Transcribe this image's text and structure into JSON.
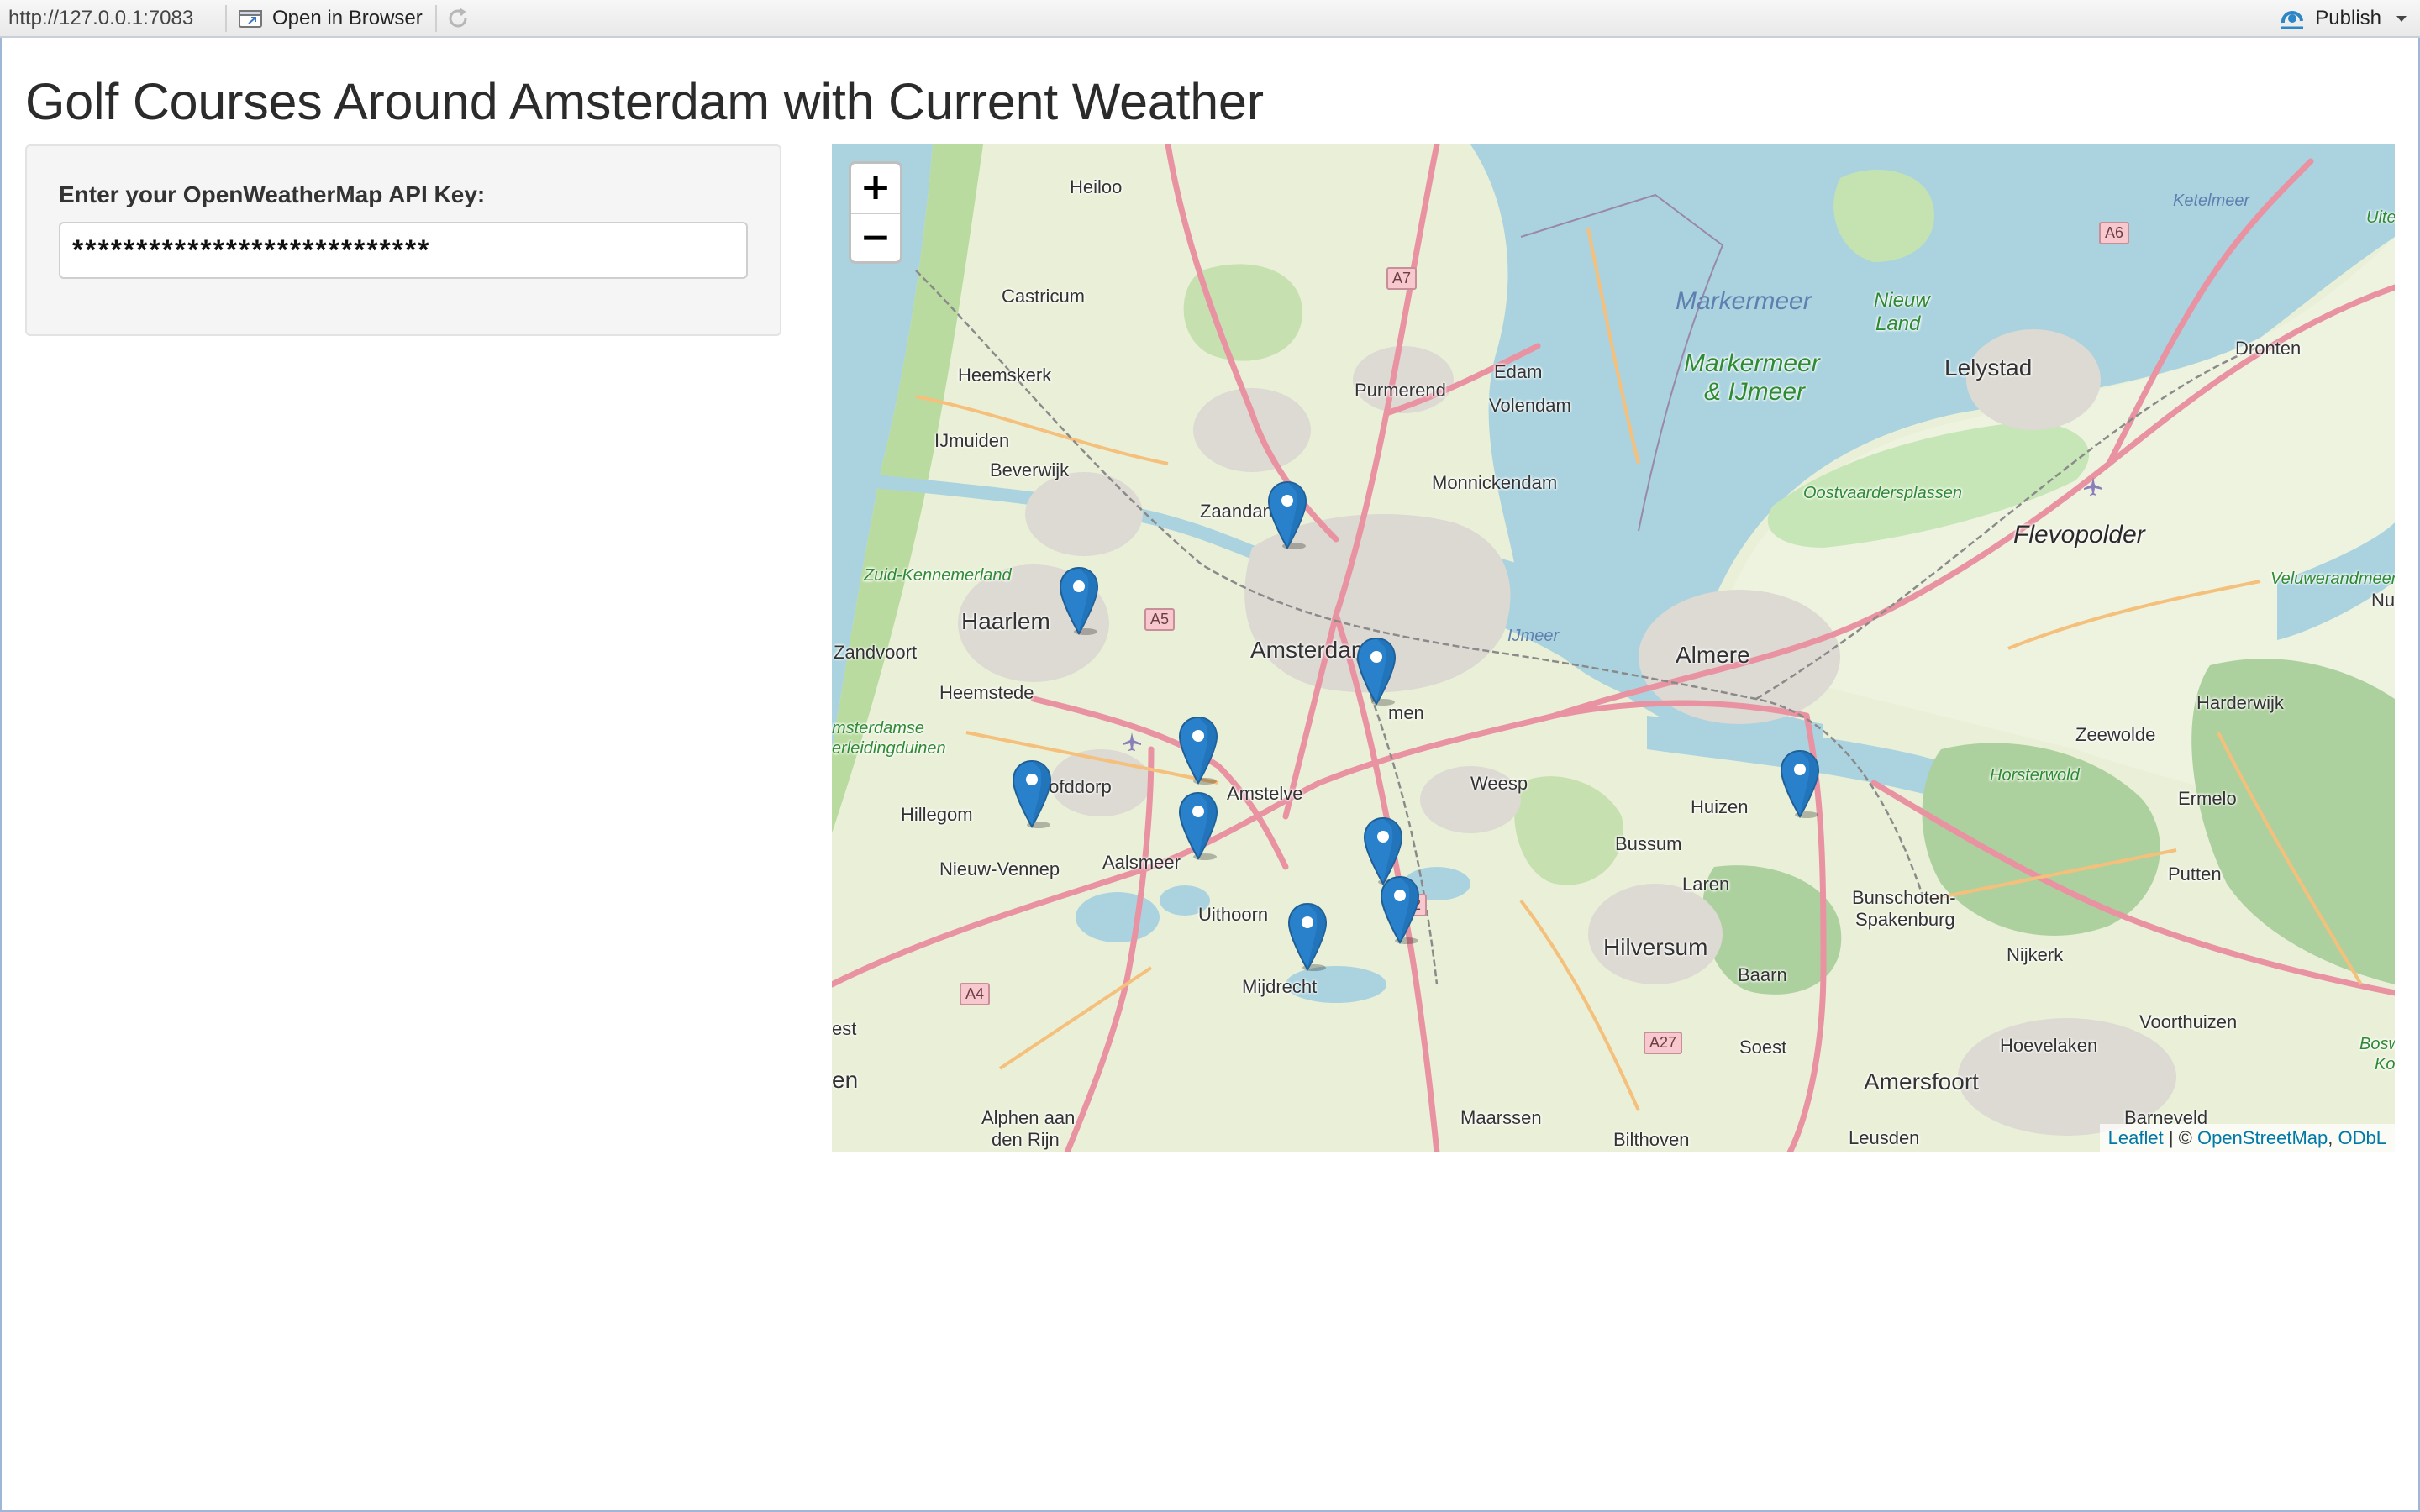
{
  "toolbar": {
    "url": "http://127.0.0.1:7083",
    "open_in_browser": "Open in Browser",
    "publish": "Publish"
  },
  "page": {
    "title": "Golf Courses Around Amsterdam with Current Weather"
  },
  "sidebar": {
    "api_key_label": "Enter your OpenWeatherMap API Key:",
    "api_key_value": "****************************"
  },
  "map": {
    "zoom_in": "+",
    "zoom_out": "−",
    "attribution": {
      "leaflet": "Leaflet",
      "separator": " | © ",
      "osm": "OpenStreetMap",
      "comma": ", ",
      "odbl": "ODbL"
    },
    "place_labels": {
      "heiloo": "Heiloo",
      "castricum": "Castricum",
      "heemskerk": "Heemskerk",
      "beverwijk": "Beverwijk",
      "ijmuiden": "IJmuiden",
      "zaandam": "Zaandam",
      "purmerend": "Purmerend",
      "edam": "Edam",
      "volendam": "Volendam",
      "monnickendam": "Monnickendam",
      "haarlem": "Haarlem",
      "zandvoort": "Zandvoort",
      "heemstede": "Heemstede",
      "amsterdam": "Amsterdam",
      "amstelveen": "Amstelve",
      "hoofddorp": "Hoofddorp",
      "hillegom": "Hillegom",
      "nieuw_vennep": "Nieuw-Vennep",
      "aalsmeer": "Aalsmeer",
      "uithoorn": "Uithoorn",
      "mijdrecht": "Mijdrecht",
      "alphen": "Alphen aan",
      "alphen2": "den Rijn",
      "weesp": "Weesp",
      "huizen": "Huizen",
      "bussum": "Bussum",
      "laren": "Laren",
      "hilversum": "Hilversum",
      "baarn": "Baarn",
      "soest": "Soest",
      "almere": "Almere",
      "lelystad": "Lelystad",
      "dronten": "Dronten",
      "harderwijk": "Harderwijk",
      "zeewolde": "Zeewolde",
      "ermelo": "Ermelo",
      "putten": "Putten",
      "nijkerk": "Nijkerk",
      "bunschoten": "Bunschoten-",
      "spakenburg": "Spakenburg",
      "hoevelaken": "Hoevelaken",
      "voorthuizen": "Voorthuizen",
      "amersfoort": "Amersfoort",
      "leusden": "Leusden",
      "barneveld": "Barneveld",
      "maarssen": "Maarssen",
      "bilthoven": "Bilthoven",
      "diemen": "men",
      "nun": "Nun",
      "markermeer": "Markermeer",
      "markermeer_ijmeer": "Markermeer",
      "markermeer_ijmeer2": "& IJmeer",
      "ijmeer": "IJmeer",
      "nieuw_land": "Nieuw",
      "nieuw_land2": "Land",
      "ketelmeer": "Ketelmeer",
      "flevopolder": "Flevopolder",
      "oostvaardersplassen": "Oostvaardersplassen",
      "zuid_kennemerland": "Zuid-Kennemerland",
      "amsterdamse": "msterdamse",
      "waterleiding": "erleidingduinen",
      "horsterwold": "Horsterwold",
      "veluwerandmeer": "Veluwerandmeer",
      "en": "en",
      "est": "est",
      "bosw": "Bosw",
      "ko": "Ko",
      "uite": "Uite"
    },
    "road_shields": {
      "a7": "A7",
      "a6": "A6",
      "a5": "A5",
      "a2": "A2",
      "a4": "A4",
      "a27": "A27"
    },
    "marker_count": 10
  }
}
